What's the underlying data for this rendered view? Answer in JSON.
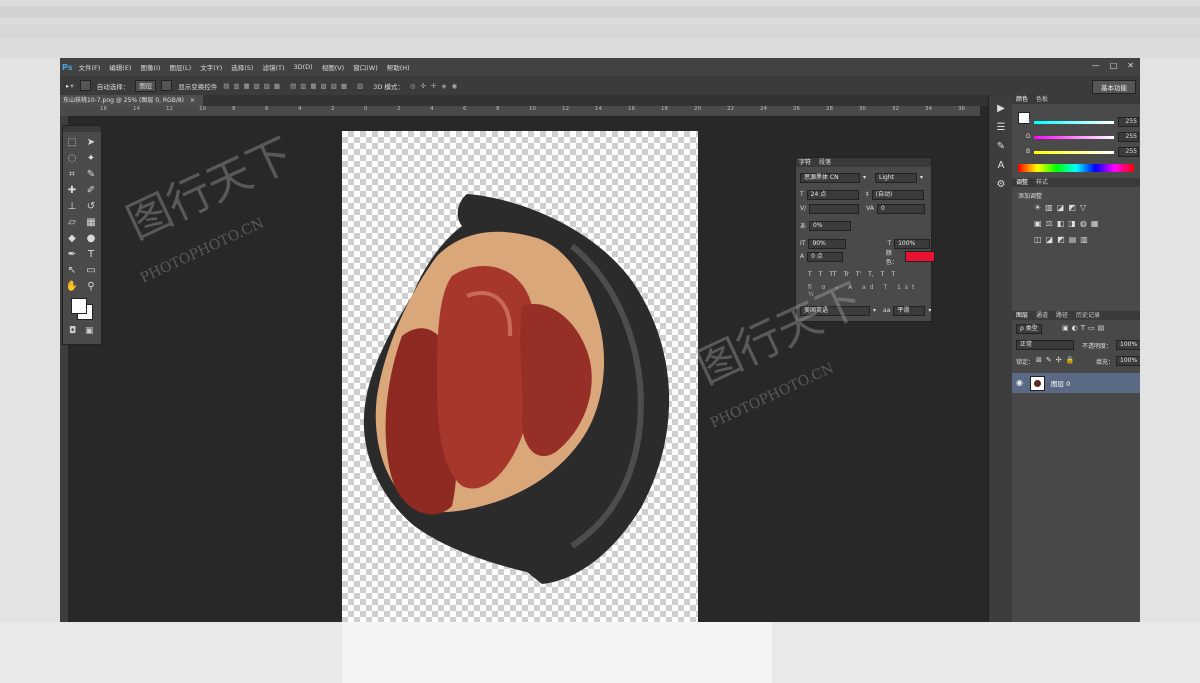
{
  "app": {
    "logo": "Ps"
  },
  "menu": [
    "文件(F)",
    "编辑(E)",
    "图像(I)",
    "图层(L)",
    "文字(Y)",
    "选择(S)",
    "滤镜(T)",
    "3D(D)",
    "视图(V)",
    "窗口(W)",
    "帮助(H)"
  ],
  "window_controls": [
    "—",
    "□",
    "✕"
  ],
  "options": {
    "auto_select_label": "自动选择：",
    "auto_select_value": "图层",
    "show_transform_label": "显示变换控件",
    "mode_3d_label": "3D 模式：",
    "workspace": "基本功能"
  },
  "document": {
    "tab_title": "东山核桃10-7.png @ 25% (图层 0, RGB/8)",
    "close": "×"
  },
  "ruler_ticks": [
    "16",
    "14",
    "12",
    "10",
    "8",
    "6",
    "4",
    "2",
    "0",
    "2",
    "4",
    "6",
    "8",
    "10",
    "12",
    "14",
    "16",
    "18",
    "20",
    "22",
    "24",
    "26",
    "28",
    "30",
    "32",
    "34",
    "36"
  ],
  "character_panel": {
    "tab_active": "字符",
    "tab_other": "段落",
    "font_family": "思源黑体 CN",
    "font_style": "Light",
    "font_size": "24 点",
    "leading": "(自动)",
    "kerning": "",
    "tracking": "0",
    "scale_pct": "0%",
    "vertical_scale": "90%",
    "horizontal_scale": "100%",
    "baseline": "0 点",
    "color_label": "颜色：",
    "color_value": "#ea1133",
    "language": "美国英语",
    "aa_label": "aa",
    "antialias": "平滑",
    "style_buttons": [
      "T",
      "T",
      "TT",
      "Tr",
      "T'",
      "T,",
      "T",
      "T"
    ]
  },
  "color_panel": {
    "tab_active": "颜色",
    "tab_other": "色板",
    "r_label": "R",
    "g_label": "G",
    "b_label": "B",
    "r": "255",
    "g": "255",
    "b": "255"
  },
  "adjust_panel": {
    "tab_active": "调整",
    "tab_other": "样式",
    "add_label": "添加调整"
  },
  "layers_panel": {
    "tabs": [
      "图层",
      "通道",
      "路径",
      "历史记录"
    ],
    "kind": "ρ 类型",
    "blend": "正常",
    "opacity_label": "不透明度：",
    "opacity": "100%",
    "lock_label": "锁定：",
    "fill_label": "填充：",
    "fill": "100%",
    "layer_name": "图层 0"
  },
  "watermarks": {
    "cn": "图行天下",
    "en": "PHOTOPHOTO.CN"
  },
  "colors": {
    "ui_bg": "#282828",
    "panel": "#4a4a4a",
    "menu": "#424242",
    "accent": "#4aa3df",
    "selected_layer": "#5a6a84"
  }
}
